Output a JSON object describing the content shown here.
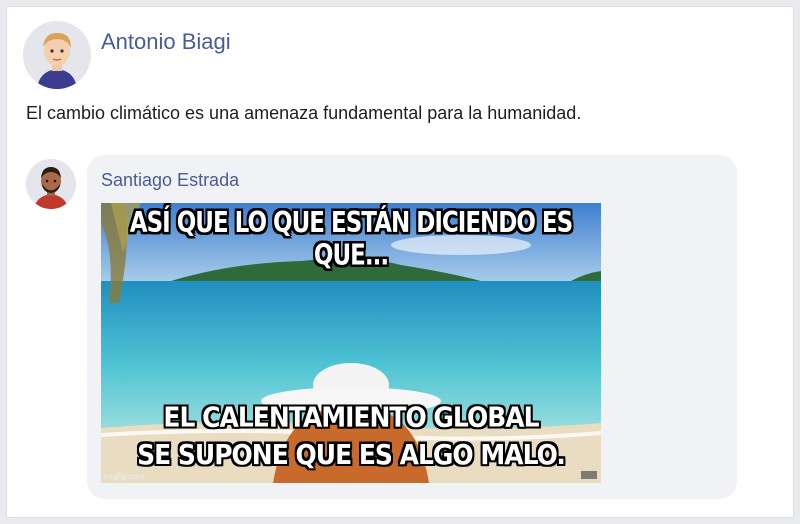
{
  "post": {
    "author": "Antonio Biagi",
    "text": "El cambio climático es una amenaza fundamental para la humanidad."
  },
  "comment": {
    "author": "Santiago Estrada",
    "meme": {
      "top_text": "ASÍ QUE LO QUE ESTÁN DICIENDO ES QUE...",
      "bottom_text_line1": "EL CALENTAMIENTO GLOBAL",
      "bottom_text_line2": "SE SUPONE QUE ES ALGO MALO.",
      "watermark": "imgflip.com"
    }
  },
  "colors": {
    "name_link": "#4a5c98",
    "bubble": "#f0f2f5"
  }
}
